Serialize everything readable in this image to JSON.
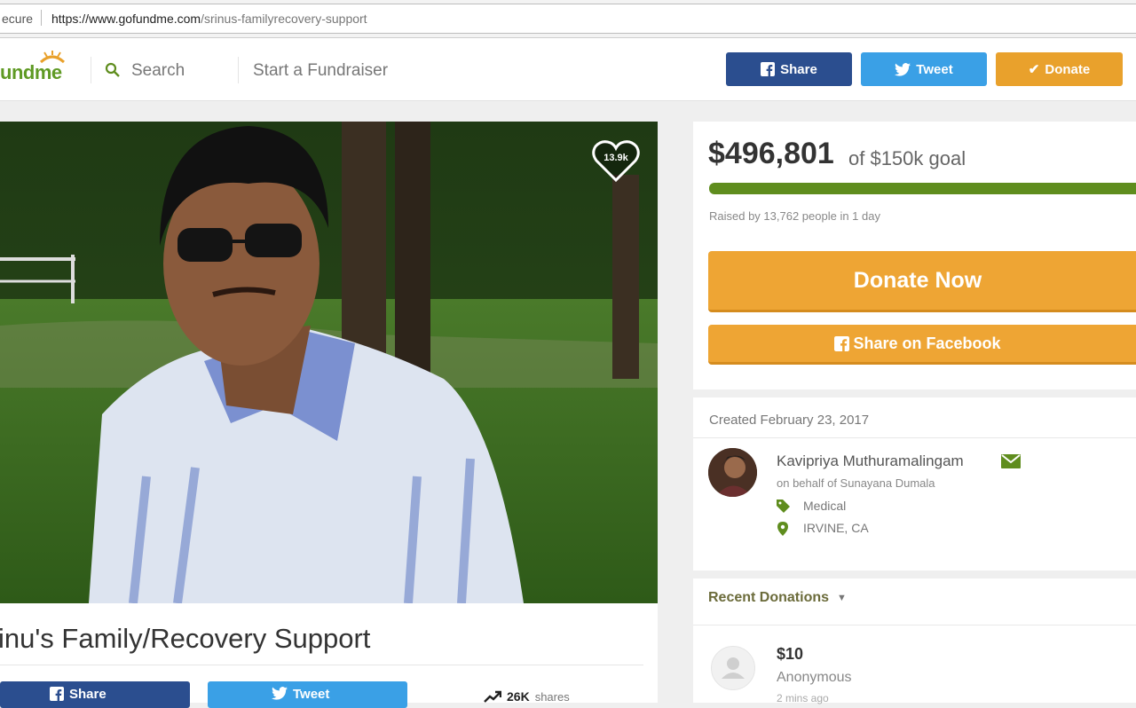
{
  "address_bar": {
    "secure_label": "ecure",
    "url_host": "https://www.gofundme.com",
    "url_path": "/srinus-familyrecovery-support"
  },
  "header": {
    "logo_text": "undme",
    "search_label": "Search",
    "start_label": "Start a Fundraiser",
    "share_label": "Share",
    "tweet_label": "Tweet",
    "donate_label": "Donate"
  },
  "photo": {
    "heart_count": "13.9k"
  },
  "campaign": {
    "title": "inu's Family/Recovery Support",
    "share_label": "Share",
    "tweet_label": "Tweet",
    "shares_count": "26K",
    "shares_label": "shares"
  },
  "funding": {
    "raised": "$496,801",
    "goal_text": "of $150k goal",
    "progress_fraction": 1.0,
    "raised_by": "Raised by 13,762 people in 1 day",
    "donate_now_label": "Donate Now",
    "share_fb_label": "Share on Facebook"
  },
  "organizer": {
    "created": "Created February 23, 2017",
    "name": "Kavipriya Muthuramalingam",
    "behalf": "on behalf of Sunayana Dumala",
    "category": "Medical",
    "location": "IRVINE, CA"
  },
  "recent": {
    "label": "Recent Donations",
    "donations": [
      {
        "amount": "$10",
        "name": "Anonymous",
        "time": "2 mins ago"
      }
    ]
  },
  "colors": {
    "facebook": "#2b4e8f",
    "twitter": "#3aa0e6",
    "donate": "#eea534",
    "brand_green": "#5f8d1e"
  }
}
